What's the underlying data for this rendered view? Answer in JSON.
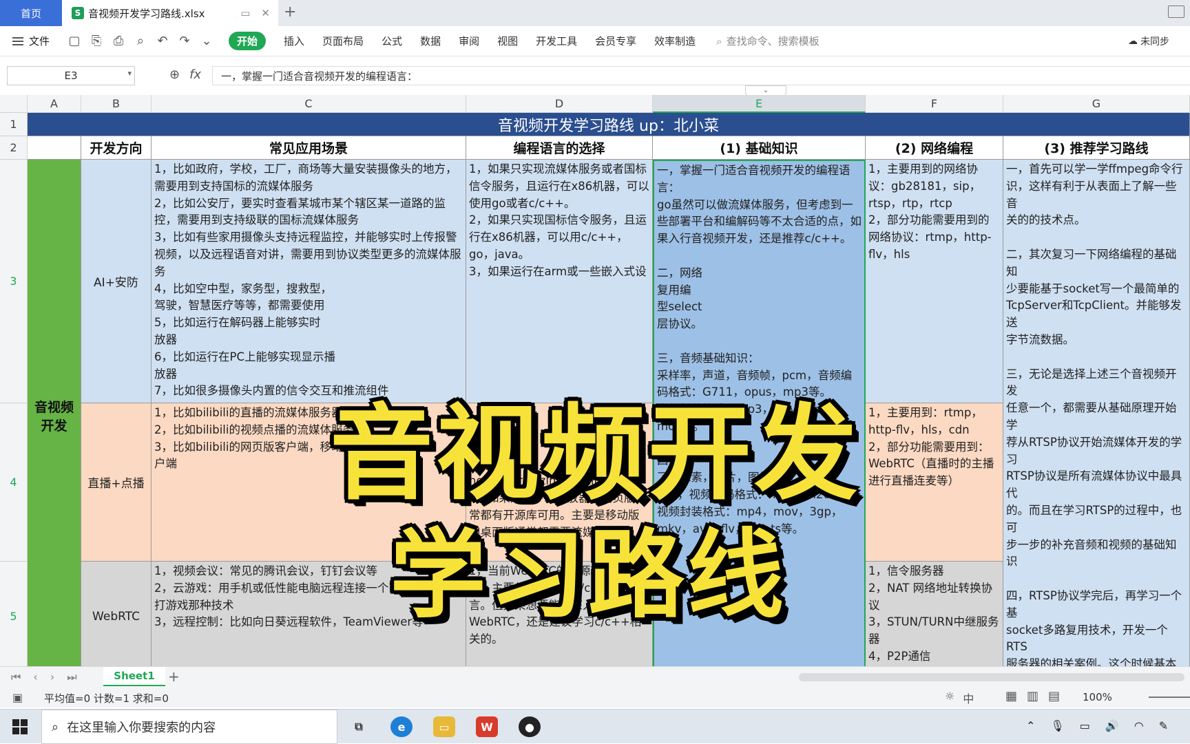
{
  "tabs": {
    "home": "首页",
    "file": "音视频开发学习路线.xlsx",
    "file_badge": "S"
  },
  "ribbon": {
    "file_menu": "文件",
    "tabs": [
      "开始",
      "插入",
      "页面布局",
      "公式",
      "数据",
      "审阅",
      "视图",
      "开发工具",
      "会员专享",
      "效率制造"
    ],
    "search_placeholder": "查找命令、搜索模板",
    "sync": "未同步"
  },
  "formula_bar": {
    "cell_ref": "E3",
    "fx": "fx",
    "content": "一，掌握一门适合音视频开发的编程语言："
  },
  "columns": [
    "A",
    "B",
    "C",
    "D",
    "E",
    "F",
    "G"
  ],
  "rows": [
    "1",
    "2",
    "3",
    "4",
    "5"
  ],
  "sheet": {
    "title": "音视频开发学习路线  up：北小菜",
    "headers": [
      "开发方向",
      "常见应用场景",
      "编程语言的选择",
      "(1) 基础知识",
      "(2) 网络编程",
      "(3) 推荐学习路线"
    ],
    "category": "音视频\n开发",
    "directions": [
      "AI+安防",
      "直播+点播",
      "WebRTC"
    ],
    "c3": "1，比如政府，学校，工厂，商场等大量安装摄像头的地方，需要用到支持国标的流媒体服务\n2，比如公安厅，要实时查看某城市某个辖区某一道路的监控，需要用到支持级联的国标流媒体服务\n3，比如有些家用摄像头支持远程监控，并能够实时上传报警视频，以及远程语音对讲，需要用到协议类型更多的流媒体服务\n4，比如空中型，家务型，搜救型，\n驾驶，智慧医疗等等，都需要使用\n5，比如运行在解码器上能够实时\n放器\n6，比如运行在PC上能够实现显示播\n放器\n7，比如很多摄像头内置的信令交互和推流组件",
    "c4": "1，比如bilibili的直播的流媒体服务器\n2，比如bilibili的视频点播的流媒体服务器\n3，比如bilibili的网页版客户端，移动版客户端，桌\n户端",
    "c5": "1，视频会议：常见的腾讯会议，钉钉会议等\n2，云游戏：用手机或低性能电脑远程连接一个高性能电脑，打游戏那种技术\n3，远程控制：比如向日葵远程软件，TeamViewer等",
    "d3": "1，如果只实现流媒体服务或者国标信令服务，且运行在x86机器，可以使用go或者c/c++。\n2，如果只实现国标信令服务，且运行在x86机器，可以用c/c++，go，java。\n3，如果运行在arm或一些嵌入式设",
    "d4": "\n\n编码还\n务，基本上都\nnginx，srs，zlmediakit。\n2，如果是客户端播放器，网页版通常都有开源库可用。主要是移动版和桌面版通常都需要流媒体开发",
    "d5": "1，当前WebRTC的开源项目比较多，主要集中在go和c/c++两种语言。但如果想要能够深入学习WebRTC，还是建议学习c/c++相关的。",
    "e3": "一，掌握一门适合音视频开发的编程语言：\ngo虽然可以做流媒体服务，但考虑到一些部署平台和编解码等不太合适的点，如果入行音视频开发，还是推荐c/c++。\n\n二，网络\n复用编\n型select\n层协议。\n\n三，音频基础知识：\n采样率，声道，音频帧，pcm，音频编码格式：G711，opus，mp3等。\n音频封装格式：mp3，wav，wma，\n                         mov等。\n\n四，\n了解像素，图片，图片格式，rgb，yuv，视频编码格式：h264，h265等，视频封装格式：mp4，mov，3gp，mkv，avi，flv，ps，ts等。",
    "f3": "1，主要用到的网络协议：gb28181，sip，rtsp，rtp，rtcp\n2，部分功能需要用到的网络协议：rtmp，http-flv，hls",
    "f4": "1，主要用到：rtmp，http-flv，hls，cdn\n2，部分功能需要用到：WebRTC（直播时的主播进行直播连麦等）",
    "f5": "1，信令服务器\n2，NAT 网络地址转换协议\n3，STUN/TURN中继服务器\n4，P2P通信",
    "g3": "一，首先可以学一学ffmpeg命令行\n识，这样有利于从表面上了解一些音\n关的的技术点。\n\n二，其次复习一下网络编程的基础知\n少要能基于socket写一个最简单的\nTcpServer和TcpClient。并能够发送\n字节流数据。\n\n三，无论是选择上述三个音视频开发\n任意一个，都需要从基础原理开始学\n荐从RTSP协议开始流媒体开发的学习\nRTSP协议是所有流媒体协议中最具代\n的。而且在学习RTSP的过程中，也可\n步一步的补充音频和视频的基础知识\n\n四，RTSP协议学完后，再学习一个基\nsocket多路复用技术，开发一个RTS\n服务器的相关案例。这个时候基本上\n搞懂了流媒体服务器是怎么一回事，\n论是学习AI安防方向，还是直播方向\n比较容易选择且目标清晰了。"
  },
  "overlay": {
    "line1": "音视频开发",
    "line2": "学习路线"
  },
  "sheet_tab": "Sheet1",
  "status": {
    "stats": "平均值=0  计数=1  求和=0",
    "zoom": "100%"
  },
  "taskbar": {
    "search": "在这里输入你要搜索的内容"
  },
  "colors": {
    "title_bg": "#2a4e8f",
    "category_green": "#67b446",
    "row3_blue": "#cfe0f2",
    "row4_peach": "#fcd9c2",
    "row5_gray": "#d6d6d6",
    "accent_green": "#20a856",
    "overlay_yellow": "#f7e23a"
  }
}
